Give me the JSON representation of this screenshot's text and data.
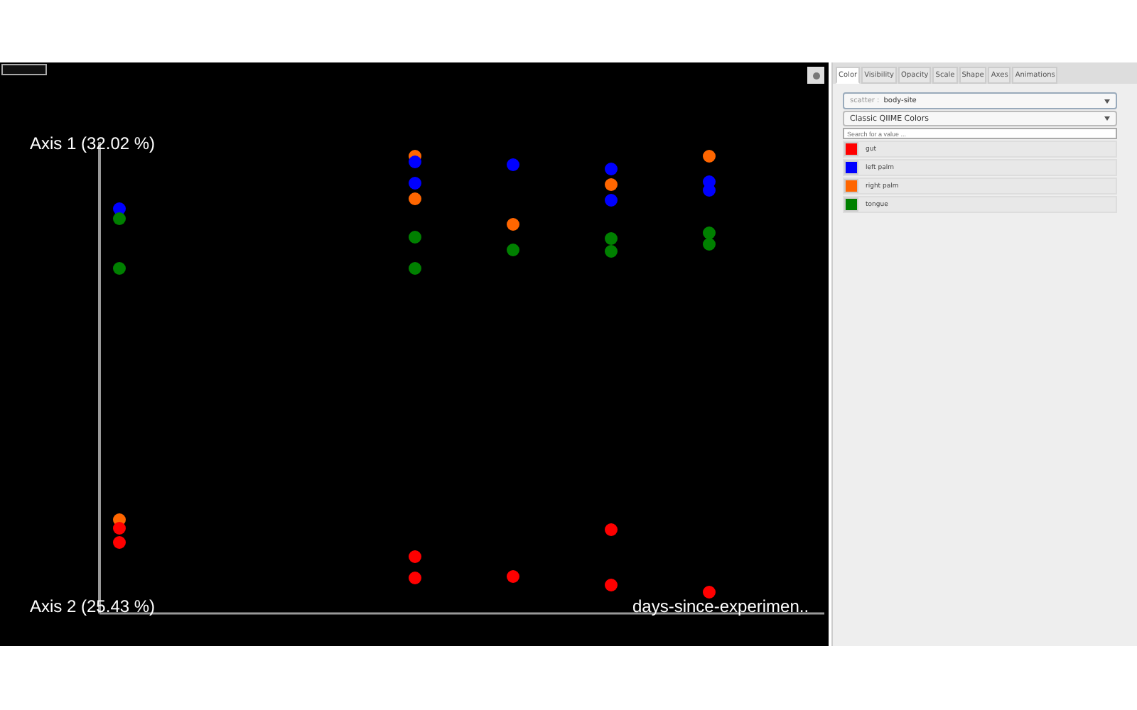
{
  "plot": {
    "axis_1_label": "Axis 1 (32.02 %)",
    "axis_2_label": "Axis 2 (25.43 %)",
    "axis_3_label": "days-since-experimen.."
  },
  "tabs": [
    {
      "label": "Color",
      "selected": true
    },
    {
      "label": "Visibility",
      "selected": false
    },
    {
      "label": "Opacity",
      "selected": false
    },
    {
      "label": "Scale",
      "selected": false
    },
    {
      "label": "Shape",
      "selected": false
    },
    {
      "label": "Axes",
      "selected": false
    },
    {
      "label": "Animations",
      "selected": false
    }
  ],
  "color_panel": {
    "category_prefix": "scatter :",
    "category": "body-site",
    "colormap": "Classic QIIME Colors",
    "search": {
      "placeholder": "Search for a value ..."
    },
    "legend": [
      {
        "label": "gut",
        "color": "#ff0000"
      },
      {
        "label": "left palm",
        "color": "#0000ff"
      },
      {
        "label": "right palm",
        "color": "#ff6600"
      },
      {
        "label": "tongue",
        "color": "#008000"
      }
    ]
  }
}
